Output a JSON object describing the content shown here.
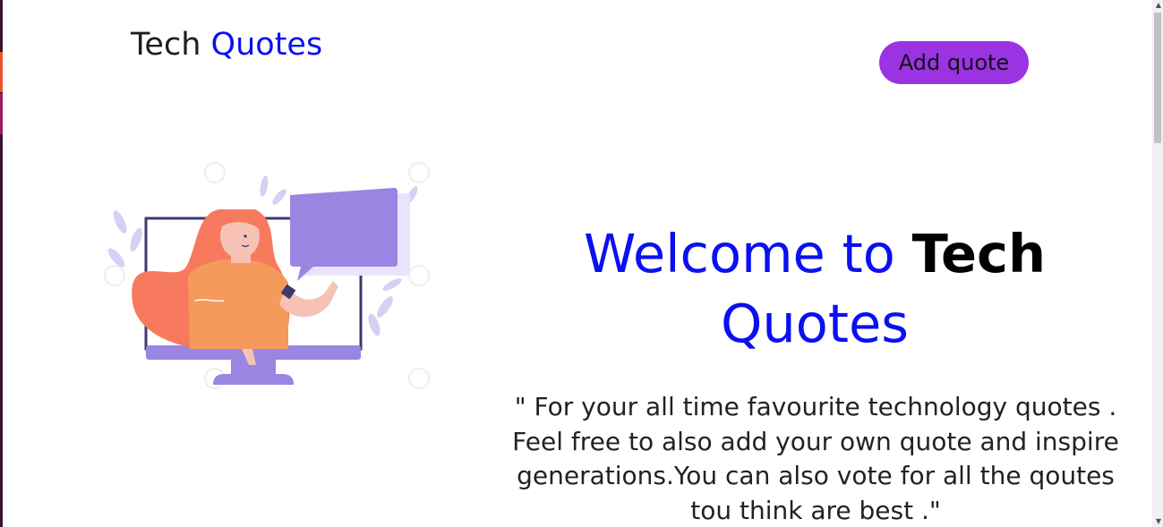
{
  "navbar": {
    "brand_part1": "Tech",
    "brand_part2": "Quotes",
    "add_button_label": "Add quote"
  },
  "hero": {
    "title_part1": "Welcome to",
    "title_part2": "Tech",
    "title_part3": "Quotes",
    "description": "\" For your all time favourite technology quotes . Feel free to also add your own quote and inspire generations.You can also vote for all the qoutes tou think are best .\""
  },
  "colors": {
    "accent_blue": "#0a10f0",
    "button_purple": "#9b33e3",
    "illustration_purple": "#9a85e3",
    "hair_coral": "#f87a5e",
    "shirt_orange": "#f59a5b"
  },
  "icons": {
    "illustration": "woman-in-monitor-illustration",
    "speech_bubble": "speech-bubble-icon"
  }
}
